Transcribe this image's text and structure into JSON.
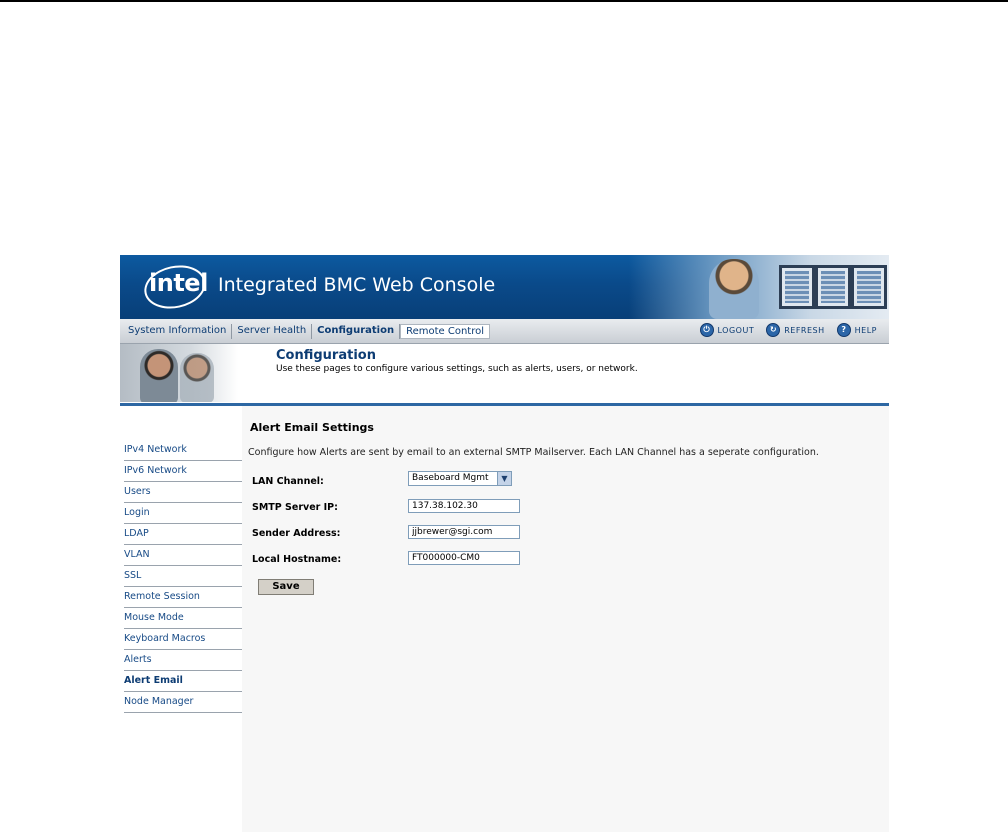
{
  "app": {
    "logo_text": "intel",
    "title": "Integrated BMC Web Console"
  },
  "nav": {
    "tabs": [
      "System Information",
      "Server Health",
      "Configuration",
      "Remote Control"
    ],
    "active_tab": "Configuration",
    "utilities": [
      {
        "label": "LOGOUT",
        "icon": "logout-icon"
      },
      {
        "label": "REFRESH",
        "icon": "refresh-icon"
      },
      {
        "label": "HELP",
        "icon": "help-icon"
      }
    ]
  },
  "header": {
    "title": "Configuration",
    "description": "Use these pages to configure various settings, such as alerts, users, or network."
  },
  "sidebar": {
    "items": [
      {
        "label": "IPv4 Network"
      },
      {
        "label": "IPv6 Network"
      },
      {
        "label": "Users"
      },
      {
        "label": "Login"
      },
      {
        "label": "LDAP"
      },
      {
        "label": "VLAN"
      },
      {
        "label": "SSL"
      },
      {
        "label": "Remote Session"
      },
      {
        "label": "Mouse Mode"
      },
      {
        "label": "Keyboard Macros"
      },
      {
        "label": "Alerts"
      },
      {
        "label": "Alert Email"
      },
      {
        "label": "Node Manager"
      }
    ],
    "active": "Alert Email"
  },
  "main": {
    "section_title": "Alert Email Settings",
    "description": "Configure how Alerts are sent by email to an external SMTP Mailserver. Each LAN Channel has a seperate configuration.",
    "fields": {
      "lan_channel": {
        "label": "LAN Channel:",
        "value": "Baseboard Mgmt"
      },
      "smtp_ip": {
        "label": "SMTP Server IP:",
        "value": "137.38.102.30"
      },
      "sender": {
        "label": "Sender Address:",
        "value": "jjbrewer@sgi.com"
      },
      "hostname": {
        "label": "Local Hostname:",
        "value": "FT000000-CM0"
      }
    },
    "save_label": "Save"
  },
  "colors": {
    "banner": "#0a4a8a",
    "link": "#174a86",
    "title": "#0d3c73",
    "rule": "#2d67a3"
  }
}
